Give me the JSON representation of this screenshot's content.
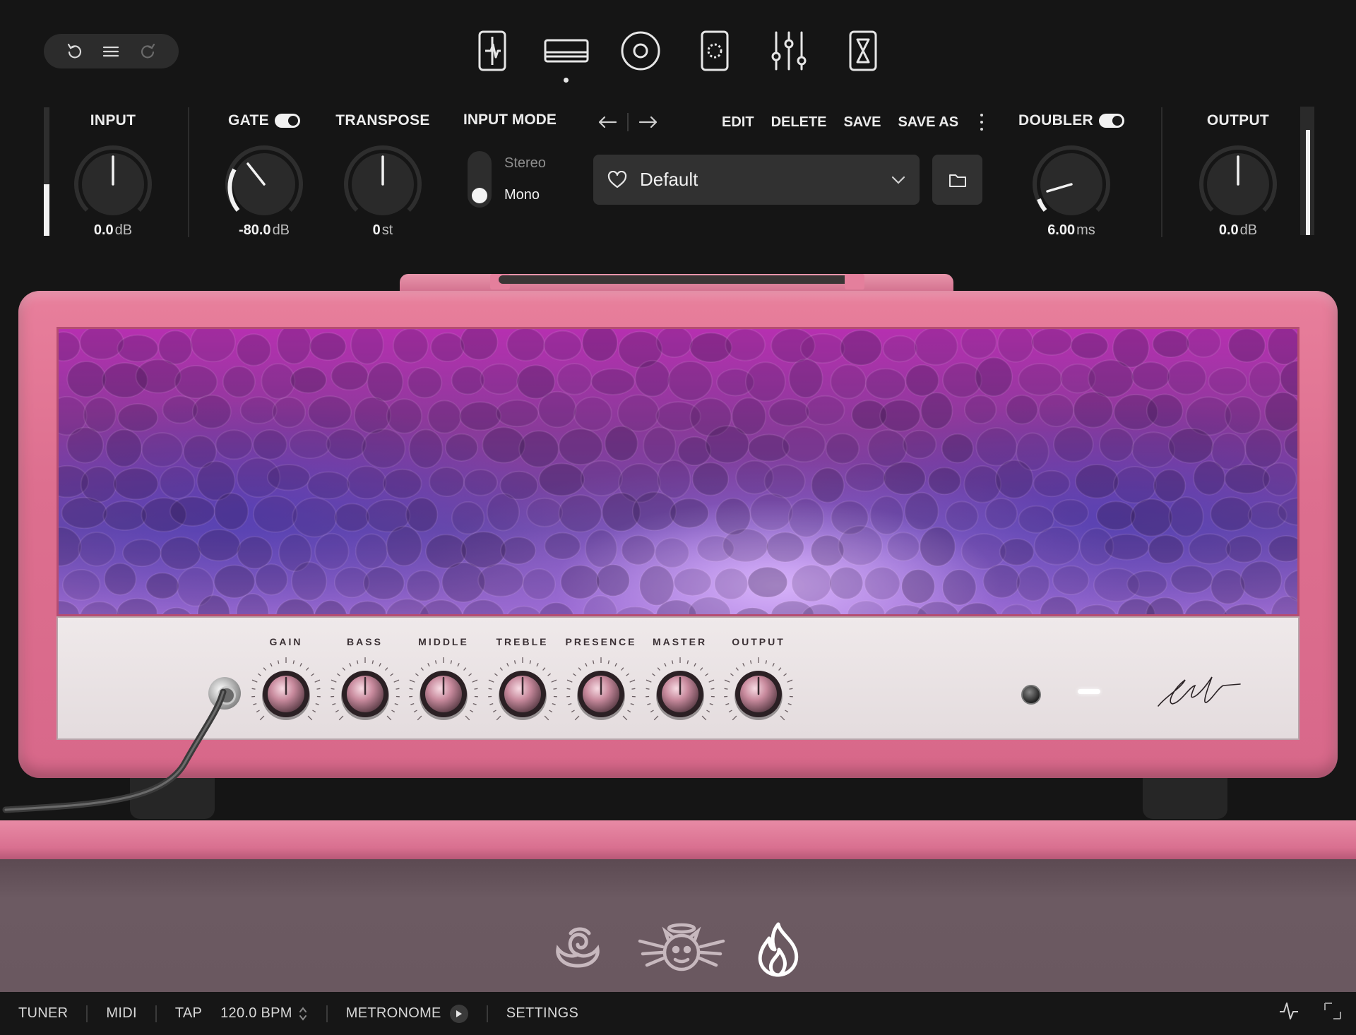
{
  "toolbar": {
    "undo_icon": "undo-icon",
    "menu_icon": "hamburger-menu-icon",
    "redo_icon": "redo-icon",
    "nav": [
      {
        "name": "pedal-icon"
      },
      {
        "name": "amp-icon",
        "active": true
      },
      {
        "name": "cabinet-speaker-icon"
      },
      {
        "name": "effects-pedal-icon"
      },
      {
        "name": "mixer-sliders-icon"
      },
      {
        "name": "timer-hourglass-icon"
      }
    ]
  },
  "header": {
    "input": {
      "label": "INPUT",
      "value": "0.0",
      "unit": "dB",
      "meter_level": 0.4
    },
    "gate": {
      "label": "GATE",
      "value": "-80.0",
      "unit": "dB",
      "enabled": true
    },
    "transpose": {
      "label": "TRANSPOSE",
      "value": "0",
      "unit": "st"
    },
    "input_mode": {
      "label": "INPUT MODE",
      "options": [
        "Stereo",
        "Mono"
      ],
      "selected": "Mono"
    },
    "preset": {
      "actions": [
        "EDIT",
        "DELETE",
        "SAVE",
        "SAVE AS"
      ],
      "name": "Default",
      "favorite_icon": "heart-icon",
      "dropdown_icon": "chevron-down-icon",
      "folder_icon": "folder-icon"
    },
    "doubler": {
      "label": "DOUBLER",
      "value": "6.00",
      "unit": "ms",
      "enabled": true
    },
    "output": {
      "label": "OUTPUT",
      "value": "0.0",
      "unit": "dB",
      "meter_level": 0.82
    }
  },
  "amp": {
    "knobs": [
      "GAIN",
      "BASS",
      "MIDDLE",
      "TREBLE",
      "PRESENCE",
      "MASTER",
      "OUTPUT"
    ]
  },
  "cabinet": {
    "icons": [
      "rose-icon",
      "angel-devil-icon",
      "flame-icon"
    ],
    "selected": "flame-icon"
  },
  "statusbar": {
    "tuner": "TUNER",
    "midi": "MIDI",
    "tap": "TAP",
    "bpm": "120.0 BPM",
    "metronome": "METRONOME",
    "settings": "SETTINGS"
  },
  "colors": {
    "background": "#151515",
    "amp_tolex": "#e07895",
    "grille_glow": "#b28cf0",
    "text": "#ececec"
  }
}
